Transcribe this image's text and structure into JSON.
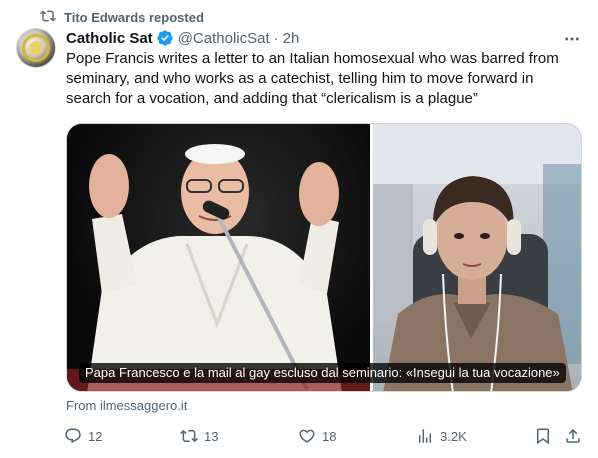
{
  "repost": {
    "text": "Tito Edwards reposted",
    "icon": "repost-icon"
  },
  "author": {
    "display_name": "Catholic Sat",
    "handle": "@CatholicSat",
    "separator": "·",
    "time": "2h",
    "verified_color": "#1d9bf0"
  },
  "tweet": {
    "text": "Pope Francis writes a letter to an Italian homosexual who was barred from seminary, and who works as a catechist, telling him to move forward in search for a vocation, and adding that “clericalism is a plague”"
  },
  "media": {
    "caption": "Papa Francesco e la mail al gay escluso dal seminario: «Insegui la tua vocazione»"
  },
  "card": {
    "source": "From ilmessaggero.it"
  },
  "actions": {
    "replies": "12",
    "reposts": "13",
    "likes": "18",
    "views": "3.2K"
  },
  "colors": {
    "text_primary": "#0f1419",
    "text_secondary": "#536471",
    "accent": "#1d9bf0",
    "border": "#cfd9de"
  }
}
